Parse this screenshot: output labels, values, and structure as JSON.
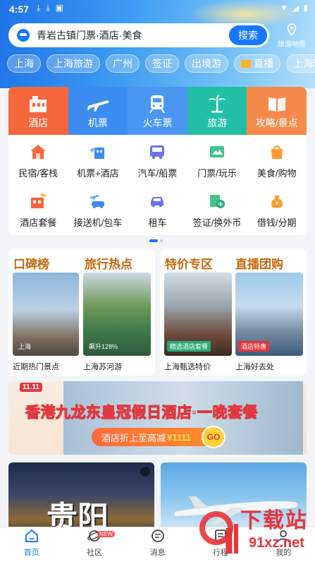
{
  "statusbar": {
    "time": "4:57"
  },
  "search": {
    "placeholder_text": "青岩古镇门票·酒店·美食",
    "button": "搜索",
    "map_label": "旅游地图"
  },
  "chips": [
    "上海",
    "上海旅游",
    "广州",
    "签证",
    "出境游",
    "直播",
    "上海欢乐谷"
  ],
  "top_services": [
    {
      "label": "酒店",
      "color": "#f4663c"
    },
    {
      "label": "机票",
      "color": "#3c8cf0"
    },
    {
      "label": "火车票",
      "color": "#4a97f2"
    },
    {
      "label": "旅游",
      "color": "#22bfa6"
    },
    {
      "label": "攻略/景点",
      "color": "#f58a4c"
    }
  ],
  "sub_services": [
    [
      "民宿/客栈",
      "机票+酒店",
      "汽车/船票",
      "门票/玩乐",
      "美食/购物"
    ],
    [
      "酒店套餐",
      "接送机/包车",
      "租车",
      "签证/换外币",
      "借钱/分期"
    ]
  ],
  "features": {
    "left": {
      "headings": [
        "口碑榜",
        "旅行热点"
      ],
      "items": [
        {
          "tag": "上海",
          "caption": "近期热门景点"
        },
        {
          "tag": "飙升128%",
          "caption": "上海苏河游"
        }
      ]
    },
    "right": {
      "headings": [
        "特价专区",
        "直播团购"
      ],
      "items": [
        {
          "tag": "精选酒店套餐",
          "caption": "上海甄选特价"
        },
        {
          "tag": "酒店特惠",
          "caption": "上海好去处"
        }
      ]
    }
  },
  "banner": {
    "badge": "11.11",
    "title": "香港九龙东皇冠假日酒店·一晚套餐",
    "promo_text": "酒店折上至高减",
    "promo_amount": "¥1111",
    "go": "GO"
  },
  "bottom_card_title": "贵阳",
  "tabbar": [
    {
      "label": "首页",
      "active": true
    },
    {
      "label": "社区",
      "badge": "NEW"
    },
    {
      "label": "消息"
    },
    {
      "label": "行程"
    },
    {
      "label": "我的"
    }
  ],
  "watermark": {
    "brand": "下载站",
    "url": "91xz.net"
  }
}
